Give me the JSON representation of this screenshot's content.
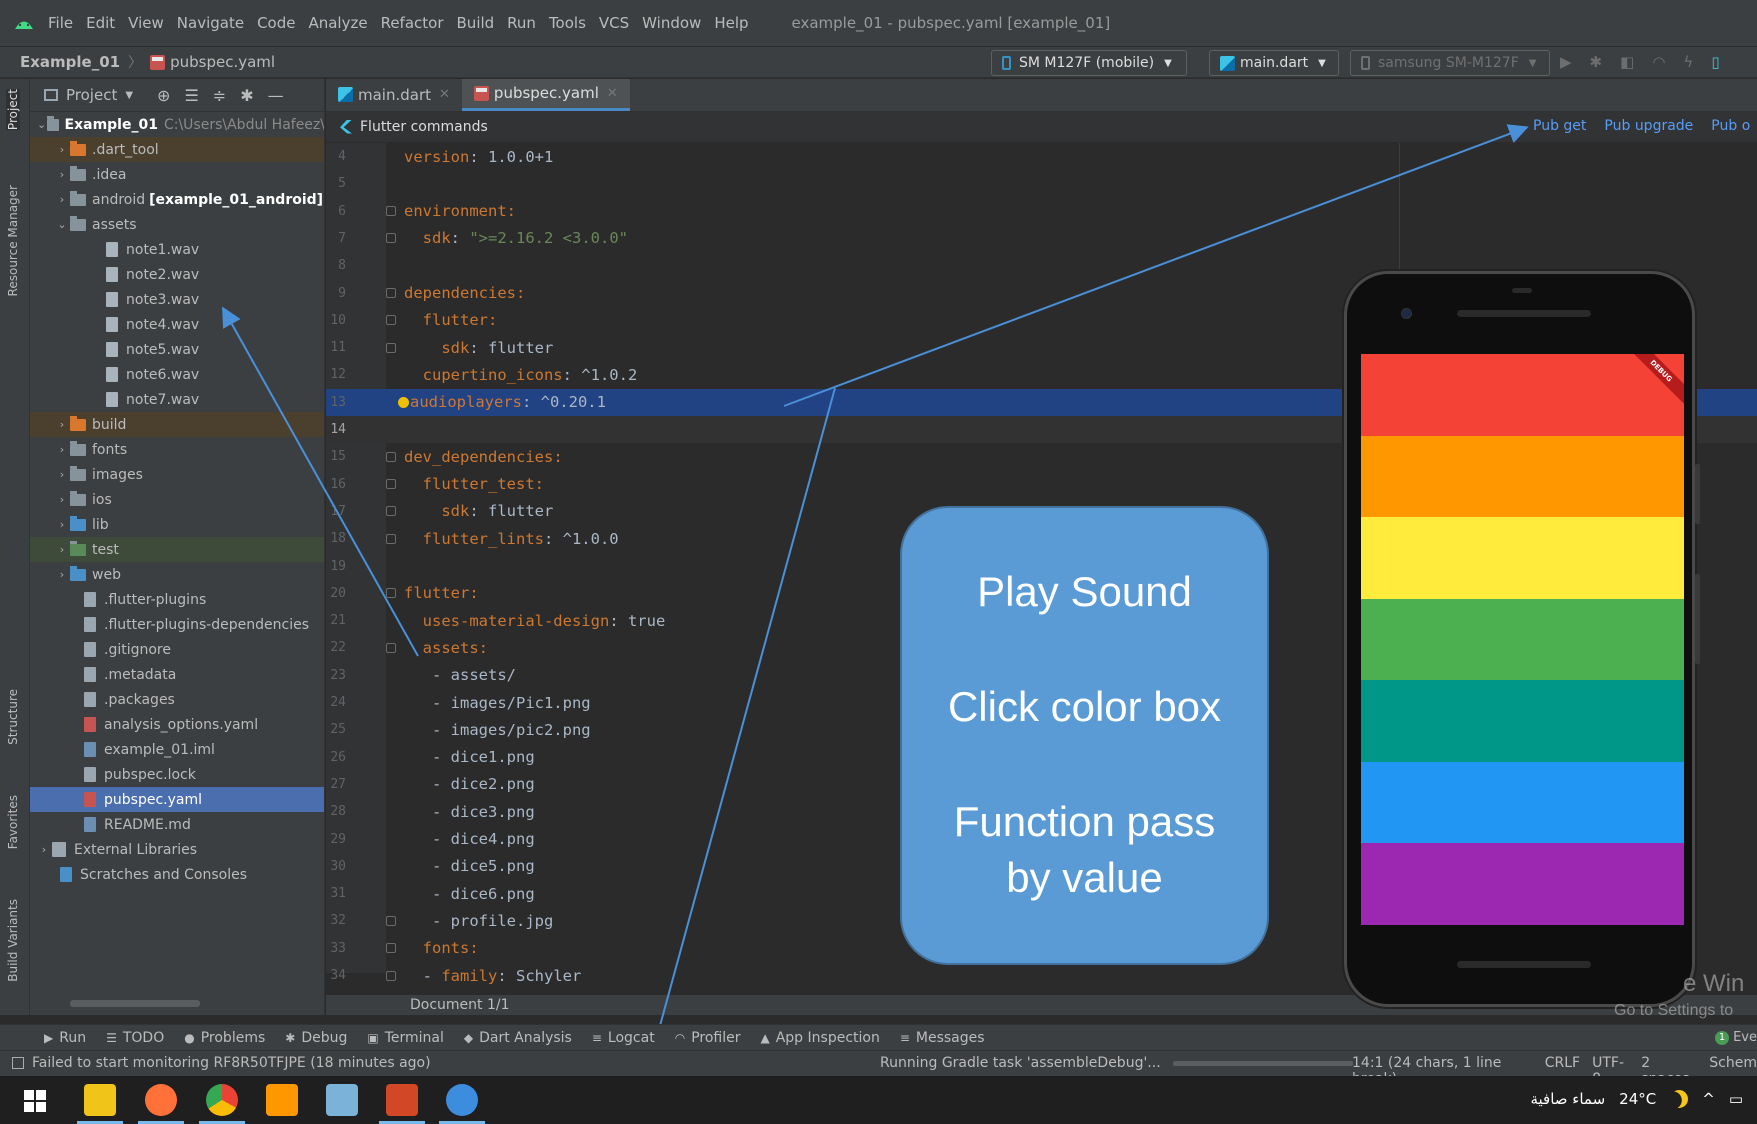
{
  "menubar": {
    "items": [
      "File",
      "Edit",
      "View",
      "Navigate",
      "Code",
      "Analyze",
      "Refactor",
      "Build",
      "Run",
      "Tools",
      "VCS",
      "Window",
      "Help"
    ],
    "window_title": "example_01 - pubspec.yaml [example_01]"
  },
  "navbar": {
    "project": "Example_01",
    "file": "pubspec.yaml",
    "device_selector": "SM M127F (mobile)",
    "run_config": "main.dart",
    "target_device": "samsung SM-M127F"
  },
  "left_strip": {
    "project": "Project",
    "resource_manager": "Resource Manager",
    "structure": "Structure",
    "favorites": "Favorites",
    "build_variants": "Build Variants"
  },
  "project_panel": {
    "title": "Project",
    "root_name": "Example_01",
    "root_path": "C:\\Users\\Abdul Hafeez\\",
    "items": {
      "dart_tool": ".dart_tool",
      "idea": ".idea",
      "android": "android",
      "android_module": "[example_01_android]",
      "assets": "assets",
      "note1": "note1.wav",
      "note2": "note2.wav",
      "note3": "note3.wav",
      "note4": "note4.wav",
      "note5": "note5.wav",
      "note6": "note6.wav",
      "note7": "note7.wav",
      "build": "build",
      "fonts": "fonts",
      "images": "images",
      "ios": "ios",
      "lib": "lib",
      "test": "test",
      "web": "web",
      "flutter_plugins": ".flutter-plugins",
      "flutter_plugins_deps": ".flutter-plugins-dependencies",
      "gitignore": ".gitignore",
      "metadata": ".metadata",
      "packages": ".packages",
      "analysis_options": "analysis_options.yaml",
      "iml": "example_01.iml",
      "pubspec_lock": "pubspec.lock",
      "pubspec_yaml": "pubspec.yaml",
      "readme": "README.md",
      "external_libraries": "External Libraries",
      "scratches": "Scratches and Consoles"
    }
  },
  "editor": {
    "tabs": [
      "main.dart",
      "pubspec.yaml"
    ],
    "flutter_commands": "Flutter commands",
    "pub_get": "Pub get",
    "pub_upgrade": "Pub upgrade",
    "pub_outdated": "Pub o",
    "line_numbers": [
      "4",
      "5",
      "6",
      "7",
      "8",
      "9",
      "10",
      "11",
      "12",
      "13",
      "14",
      "15",
      "16",
      "17",
      "18",
      "19",
      "20",
      "21",
      "22",
      "23",
      "24",
      "25",
      "26",
      "27",
      "28",
      "29",
      "30",
      "31",
      "32",
      "33",
      "34"
    ],
    "code": {
      "l4_key": "version",
      "l4_val": ": 1.0.0+1",
      "l6_key": "environment",
      "l6_val": ":",
      "l7_key": "  sdk",
      "l7_colon": ": ",
      "l7_val": "\">=2.16.2 <3.0.0\"",
      "l9_key": "dependencies",
      "l9_val": ":",
      "l10_key": "  flutter",
      "l10_val": ":",
      "l11_key": "    sdk",
      "l11_val": ": flutter",
      "l12_key": "  cupertino_icons",
      "l12_val": ": ^1.0.2",
      "l13_key": "audioplayers",
      "l13_val": ": ^0.20.1",
      "l15_key": "dev_dependencies",
      "l15_val": ":",
      "l16_key": "  flutter_test",
      "l16_val": ":",
      "l17_key": "    sdk",
      "l17_val": ": flutter",
      "l18_key": "  flutter_lints",
      "l18_val": ": ^1.0.0",
      "l20_key": "flutter",
      "l20_val": ":",
      "l21_key": "  uses-material-design",
      "l21_val": ": true",
      "l22_key": "  assets",
      "l22_val": ":",
      "l23": "   - assets/",
      "l24": "   - images/Pic1.png",
      "l25": "   - images/pic2.png",
      "l26": "   - dice1.png",
      "l27": "   - dice2.png",
      "l28": "   - dice3.png",
      "l29": "   - dice4.png",
      "l30": "   - dice5.png",
      "l31": "   - dice6.png",
      "l32": "   - profile.jpg",
      "l33_key": "  fonts",
      "l33_val": ":",
      "l34_dash": "  - ",
      "l34_key": "family",
      "l34_val": ": Schyler"
    },
    "document_status": "Document 1/1"
  },
  "callout": {
    "line1": "Play Sound",
    "line2": "Click color box",
    "line3": "Function pass",
    "line4": "by value"
  },
  "phone": {
    "debug_label": "DEBUG",
    "colors": [
      "#f44336",
      "#ff9800",
      "#ffeb3b",
      "#4caf50",
      "#009688",
      "#2196f3",
      "#9c27b0"
    ]
  },
  "watermark": {
    "line1": "e Win",
    "line2": "Go to Settings to"
  },
  "tool_tabs": [
    "Run",
    "TODO",
    "Problems",
    "Debug",
    "Terminal",
    "Dart Analysis",
    "Logcat",
    "Profiler",
    "App Inspection",
    "Messages"
  ],
  "event_log": {
    "count": "1",
    "label": "Eve"
  },
  "status": {
    "message": "Failed to start monitoring RF8R50TFJPE (18 minutes ago)",
    "task": "Running Gradle task 'assembleDebug'...",
    "progress": 0.0,
    "position": "14:1 (24 chars, 1 line break)",
    "line_ending": "CRLF",
    "encoding": "UTF-8",
    "indent": "2 spaces",
    "schema": "Schem"
  },
  "taskbar": {
    "weather": "24°C",
    "weather_text": "سماء صافية"
  }
}
